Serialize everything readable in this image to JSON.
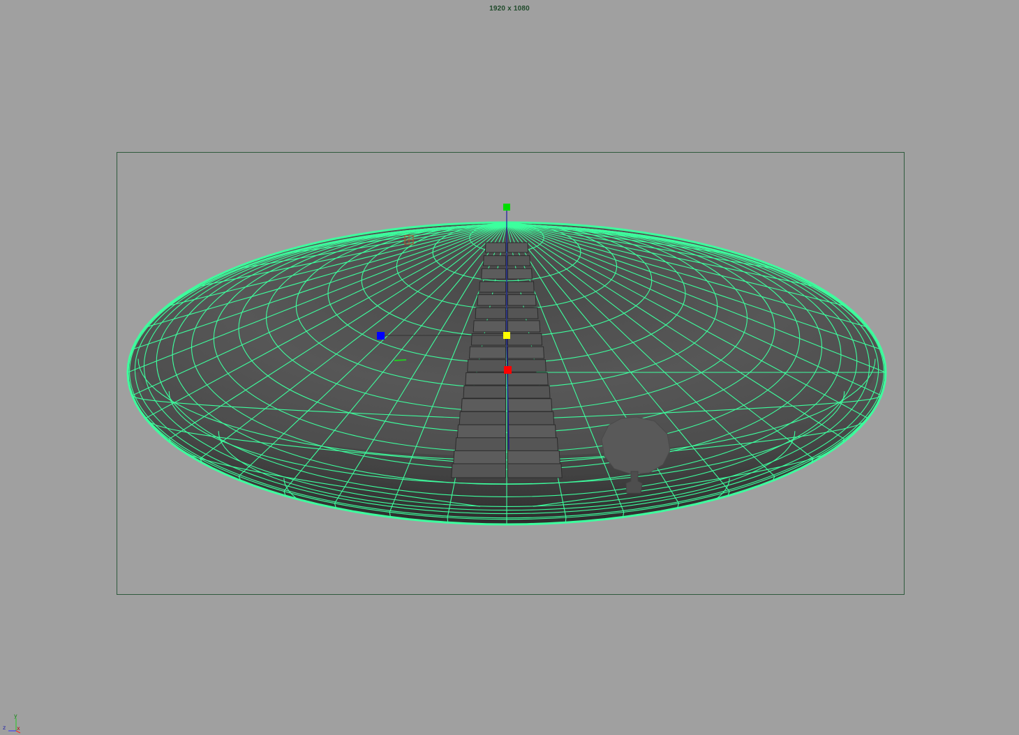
{
  "viewport": {
    "resolution_label": "1920 x 1080",
    "background_color": "#a0a0a0",
    "gate_color": "#2e5a3c",
    "wireframe_color": "#3dff9e",
    "mesh_color": "#5b5b5b"
  },
  "manipulator": {
    "x_handle_color": "#ff0000",
    "y_handle_color": "#00dd00",
    "z_handle_color": "#0000ff",
    "center_handle_color": "#ffff00"
  },
  "objects": [
    {
      "name": "disc-ground"
    },
    {
      "name": "stepped-path"
    },
    {
      "name": "tree"
    }
  ],
  "axis_indicator": {
    "z_label": "z",
    "x_label": "x",
    "y_label": "y"
  }
}
